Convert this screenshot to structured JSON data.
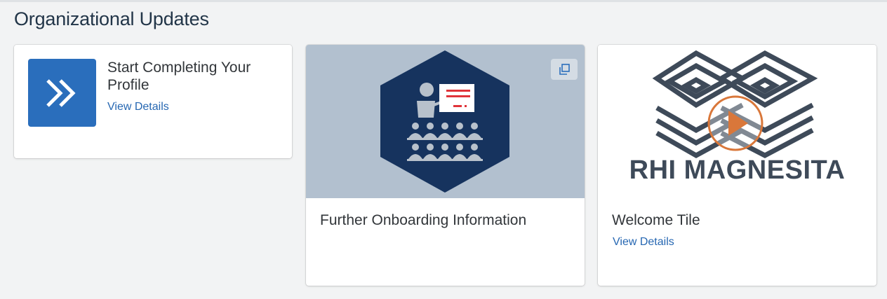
{
  "section": {
    "title": "Organizational Updates"
  },
  "tiles": [
    {
      "title": "Start Completing Your Profile",
      "link": "View Details",
      "icon": "double-chevron-right-icon"
    },
    {
      "title": "Further Onboarding Information",
      "image": "presentation-audience-illustration",
      "action_icon": "open-in-new-window-icon"
    },
    {
      "title": "Welcome Tile",
      "link": "View Details",
      "image": "rhi-magnesita-logo-video",
      "logo_text": "RHI MAGNESITA"
    }
  ],
  "colors": {
    "background": "#f2f3f4",
    "title": "#223548",
    "link": "#2667b2",
    "tile_accent": "#2a6ebc",
    "onboard_bg": "#b2c0cf",
    "hexagon": "#16335e",
    "logo_gray": "#3e4a59",
    "play_orange": "#d9773a"
  }
}
